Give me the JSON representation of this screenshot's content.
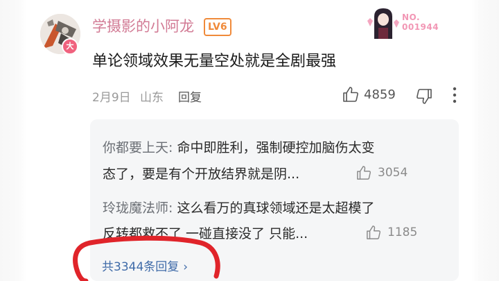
{
  "comment": {
    "username": "学摄影的小阿龙",
    "level": "LV6",
    "avatar_badge": "大",
    "fan_number": "NO.\n001944",
    "text": "单论领域效果无量空处就是全剧最强",
    "date": "2月9日",
    "location": "山东",
    "reply_label": "回复",
    "like_count": "4859"
  },
  "replies": [
    {
      "name": "你都要上天:",
      "line1": " 命中即胜利，强制硬控加脑伤太变",
      "line2": "态了，要是有个开放结界就是阴...",
      "like_count": "3054"
    },
    {
      "name": "玲珑魔法师:",
      "line1": " 这么看万的真球领域还是太超模了",
      "line2": "反转都救不了 一碰直接没了 只能...",
      "like_count": "1185"
    }
  ],
  "total_replies": "共3344条回复",
  "total_chevron": "›",
  "colors": {
    "username": "#d27b95",
    "level": "#f08a3a",
    "link": "#3e6aa8",
    "annotation": "#e0242a"
  }
}
